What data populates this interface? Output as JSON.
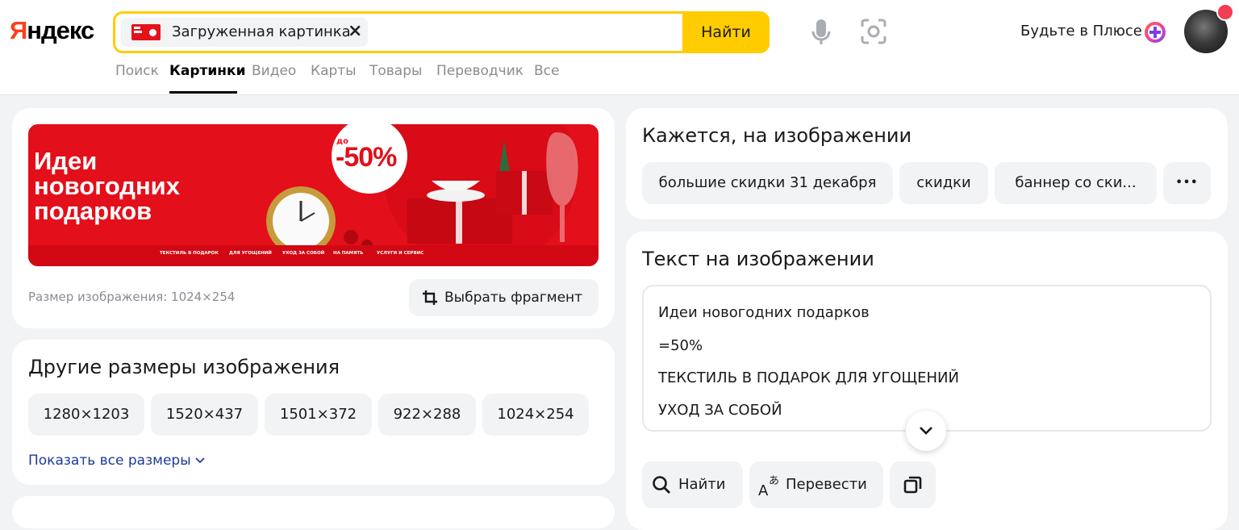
{
  "header": {
    "logo": {
      "first_letter": "Я",
      "rest": "ндекс"
    },
    "search": {
      "chip_label": "Загруженная картинка",
      "clear_glyph": "×",
      "find_label": "Найти"
    },
    "icons": [
      "microphone-icon",
      "camera-scan-icon",
      "plus-logo-icon",
      "avatar"
    ],
    "plus_label": "Будьте в Плюсе",
    "tabs": [
      {
        "label": "Поиск",
        "active": false
      },
      {
        "label": "Картинки",
        "active": true
      },
      {
        "label": "Видео",
        "active": false
      },
      {
        "label": "Карты",
        "active": false
      },
      {
        "label": "Товары",
        "active": false
      },
      {
        "label": "Переводчик",
        "active": false
      },
      {
        "label": "Все",
        "active": false
      }
    ]
  },
  "preview": {
    "banner": {
      "title": "Идеи\nновогодних\nподарков",
      "badge_prefix": "до",
      "badge_value": "-50%",
      "strip_items": [
        "ТЕКСТИЛЬ В ПОДАРОК",
        "ДЛЯ УГОЩЕНИЙ",
        "УХОД ЗА СОБОЙ",
        "НА ПАМЯТЬ",
        "УСЛУГИ И СЕРВИС"
      ]
    },
    "size_label": "Размер изображения: 1024×254",
    "fragment_button": "Выбрать фрагмент"
  },
  "other_sizes": {
    "title": "Другие размеры изображения",
    "sizes": [
      "1280×1203",
      "1520×437",
      "1501×372",
      "922×288",
      "1024×254"
    ],
    "show_all": "Показать все размеры"
  },
  "seems": {
    "title": "Кажется, на изображении",
    "tags": [
      "большие скидки 31 декабря",
      "скидки",
      "баннер со ски..."
    ],
    "more_glyph": "•••"
  },
  "text_on_image": {
    "title": "Текст на изображении",
    "lines": [
      "Идеи новогодних подарков",
      "=50%",
      "ТЕКСТИЛЬ В ПОДАРОК ДЛЯ УГОЩЕНИЙ",
      "УХОД ЗА СОБОЙ"
    ],
    "actions": {
      "find": "Найти",
      "translate": "Перевести"
    }
  },
  "colors": {
    "accent": "#ffcc00",
    "brand_red": "#fc3f1d",
    "link": "#1d3b93",
    "banner_red": "#e30f1a"
  }
}
